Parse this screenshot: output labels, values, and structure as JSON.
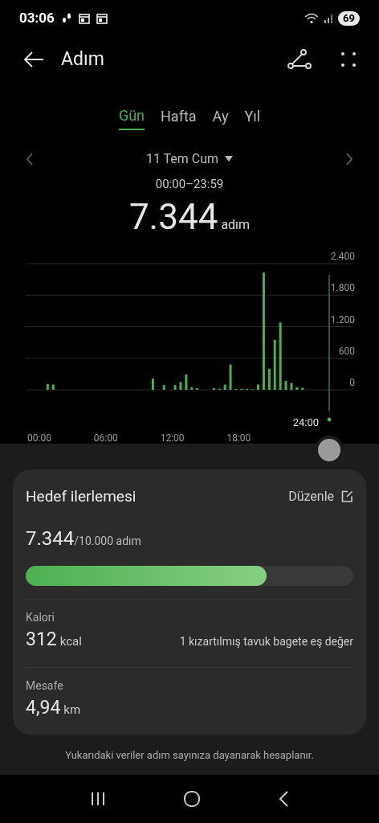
{
  "status_bar": {
    "time": "03:06",
    "battery": "69"
  },
  "header": {
    "title": "Adım"
  },
  "tabs": [
    {
      "label": "Gün",
      "selected": true
    },
    {
      "label": "Hafta",
      "selected": false
    },
    {
      "label": "Ay",
      "selected": false
    },
    {
      "label": "Yıl",
      "selected": false
    }
  ],
  "date": {
    "label": "11 Tem Cum",
    "range": "00:00–23:59"
  },
  "total": {
    "value": "7.344",
    "unit": "adım"
  },
  "chart": {
    "cursor_label": "24:00",
    "chart_data": {
      "type": "bar",
      "x": [
        0.5,
        1,
        10,
        11,
        12,
        12.5,
        13,
        13.5,
        14,
        15.5,
        16,
        16.5,
        17,
        17.5,
        18,
        18.5,
        19,
        19.5,
        20,
        20.5,
        21,
        21.5,
        22,
        22.5,
        23,
        23.5
      ],
      "values": [
        110,
        100,
        210,
        90,
        90,
        150,
        290,
        50,
        30,
        30,
        20,
        100,
        480,
        20,
        20,
        20,
        10,
        100,
        2230,
        400,
        950,
        1280,
        170,
        130,
        50,
        40
      ],
      "grid": true,
      "color": "#4caf50",
      "xlim": [
        0,
        24
      ],
      "ylim": [
        0,
        2400
      ],
      "xticks": [
        {
          "value": 0,
          "label": "00:00"
        },
        {
          "value": 6,
          "label": "06:00"
        },
        {
          "value": 12,
          "label": "12:00"
        },
        {
          "value": 18,
          "label": "18:00"
        }
      ],
      "yticks": [
        {
          "value": 0,
          "label": "0"
        },
        {
          "value": 600,
          "label": "600"
        },
        {
          "value": 1200,
          "label": "1.200"
        },
        {
          "value": 1800,
          "label": "1.800"
        },
        {
          "value": 2400,
          "label": "2.400"
        }
      ]
    }
  },
  "goal_card": {
    "title": "Hedef ilerlemesi",
    "edit": "Düzenle",
    "value": "7.344",
    "target": "/10.000 adım",
    "level": 0.7344,
    "metrics": [
      {
        "label": "Kalori",
        "value": "312",
        "unit": "kcal",
        "note": "1 kızartılmış tavuk bagete eş değer"
      },
      {
        "label": "Mesafe",
        "value": "4,94",
        "unit": "km"
      }
    ]
  },
  "footnote": "Yukarıdaki veriler adım sayınıza dayanarak hesaplanır."
}
